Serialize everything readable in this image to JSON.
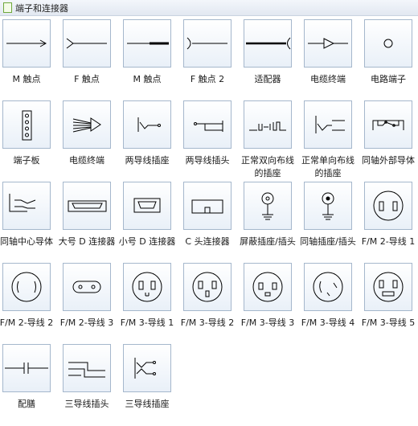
{
  "header": {
    "title": "端子和连接器"
  },
  "items": [
    {
      "label": "M 触点",
      "icon": "male-contact-icon"
    },
    {
      "label": "F 触点",
      "icon": "female-contact-icon"
    },
    {
      "label": "M 触点",
      "icon": "male-contact-thick-icon"
    },
    {
      "label": "F 触点 2",
      "icon": "female-contact-2-icon"
    },
    {
      "label": "适配器",
      "icon": "adapter-icon"
    },
    {
      "label": "电缆终端",
      "icon": "cable-terminal-icon"
    },
    {
      "label": "电路端子",
      "icon": "circuit-terminal-icon"
    },
    {
      "label": "端子板",
      "icon": "terminal-board-icon"
    },
    {
      "label": "电缆终端",
      "icon": "cable-termination-icon"
    },
    {
      "label": "两导线插座",
      "icon": "two-wire-socket-icon"
    },
    {
      "label": "两导线插头",
      "icon": "two-wire-plug-icon"
    },
    {
      "label": "正常双向布线的插座",
      "icon": "normal-bidirectional-jack-icon"
    },
    {
      "label": "正常单向布线的插座",
      "icon": "normal-unidirectional-jack-icon"
    },
    {
      "label": "同轴外部导体",
      "icon": "coax-outer-conductor-icon"
    },
    {
      "label": "同轴中心导体",
      "icon": "coax-center-conductor-icon"
    },
    {
      "label": "大号 D 连接器",
      "icon": "large-d-connector-icon"
    },
    {
      "label": "小号 D 连接器",
      "icon": "small-d-connector-icon"
    },
    {
      "label": "C 头连接器",
      "icon": "c-connector-icon"
    },
    {
      "label": "屏蔽插座/插头",
      "icon": "shielded-jack-icon"
    },
    {
      "label": "同轴插座/插头",
      "icon": "coax-jack-icon"
    },
    {
      "label": "F/M 2-导线 1",
      "icon": "fm-2-wire-1-icon"
    },
    {
      "label": "F/M 2-导线 2",
      "icon": "fm-2-wire-2-icon"
    },
    {
      "label": "F/M 2-导线 3",
      "icon": "fm-2-wire-3-icon"
    },
    {
      "label": "F/M 3-导线 1",
      "icon": "fm-3-wire-1-icon"
    },
    {
      "label": "F/M 3-导线 2",
      "icon": "fm-3-wire-2-icon"
    },
    {
      "label": "F/M 3-导线 3",
      "icon": "fm-3-wire-3-icon"
    },
    {
      "label": "F/M 3-导线 4",
      "icon": "fm-3-wire-4-icon"
    },
    {
      "label": "F/M 3-导线 5",
      "icon": "fm-3-wire-5-icon"
    },
    {
      "label": "配膳",
      "icon": "splice-icon"
    },
    {
      "label": "三导线插头",
      "icon": "three-wire-plug-icon"
    },
    {
      "label": "三导线插座",
      "icon": "three-wire-socket-icon"
    }
  ]
}
